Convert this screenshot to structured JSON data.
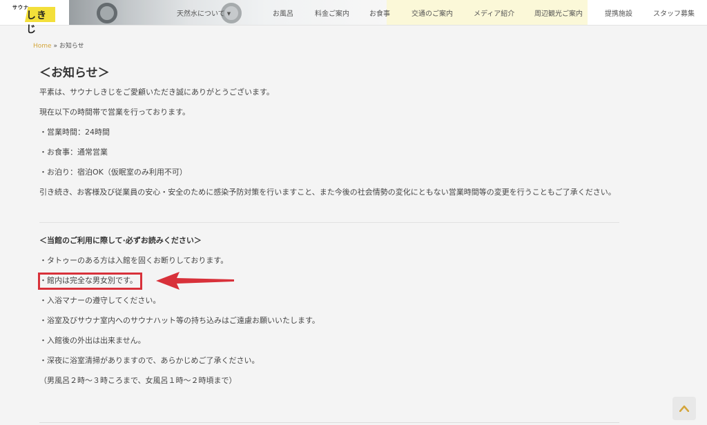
{
  "logo": {
    "small_text": "サウナ",
    "main_text": "しきじ"
  },
  "nav": {
    "items": [
      {
        "label": "天然水について",
        "has_dropdown": true
      },
      {
        "label": "お風呂"
      },
      {
        "label": "料金ご案内"
      },
      {
        "label": "お食事"
      },
      {
        "label": "交通のご案内"
      },
      {
        "label": "メディア紹介"
      },
      {
        "label": "周辺観光ご案内"
      },
      {
        "label": "提携施設"
      },
      {
        "label": "スタッフ募集"
      }
    ],
    "dropdown_icon": "chevron-down-icon"
  },
  "breadcrumb": {
    "home": "Home",
    "separator": "»",
    "current": "お知らせ"
  },
  "page": {
    "title": "＜お知らせ＞",
    "paragraphs": [
      "平素は、サウナしきじをご愛顧いただき誠にありがとうございます。",
      "現在以下の時間帯で営業を行っております。",
      "・営業時間：24時間",
      "・お食事：通常営業",
      "・お泊り：宿泊OK（仮眠室のみ利用不可）",
      "引き続き、お客様及び従業員の安心・安全のために感染予防対策を行いますこと、また今後の社会情勢の変化にともない営業時間等の変更を行うこともご了承ください。"
    ],
    "section_heading": "＜当館のご利用に際して·必ずお読みください＞",
    "rules": [
      "・タトゥーのある方は入館を固くお断りしております。",
      "・館内は完全な男女別です。",
      "・入浴マナーの遵守してください。",
      "・浴室及びサウナ室内へのサウナハット等の持ち込みはご遠慮お願いいたします。",
      "・入館後の外出は出来ません。",
      "・深夜に浴室清掃がありますので、あらかじめご了承ください。",
      "（男風呂２時〜３時ころまで、女風呂１時〜２時頃まで）"
    ]
  },
  "colors": {
    "accent": "#d4a53a",
    "highlight": "#d8313a",
    "logo_yellow": "#f3df3a"
  },
  "scroll_top": {
    "icon": "chevron-up-icon"
  }
}
